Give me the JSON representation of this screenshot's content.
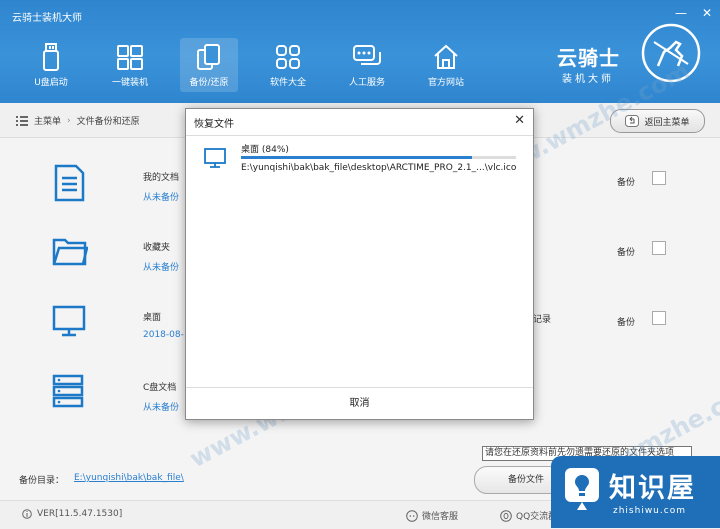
{
  "window": {
    "title": "云骑士装机大师",
    "minimize": "—",
    "close": "✕"
  },
  "nav": [
    {
      "label": "U盘启动",
      "icon": "usb-drive-icon"
    },
    {
      "label": "一键装机",
      "icon": "windows-icon"
    },
    {
      "label": "备份/还原",
      "icon": "backup-restore-icon"
    },
    {
      "label": "软件大全",
      "icon": "apps-grid-icon"
    },
    {
      "label": "人工服务",
      "icon": "chat-bubble-icon"
    },
    {
      "label": "官方网站",
      "icon": "home-icon"
    }
  ],
  "brand": {
    "name": "云骑士",
    "subtitle": "装机大师"
  },
  "breadcrumb": {
    "root": "主菜单",
    "current": "文件备份和还原"
  },
  "back_button": "返回主菜单",
  "rows": [
    {
      "name": "我的文档",
      "sub": "从未备份",
      "right": "",
      "action": "备份",
      "icon": "document-icon"
    },
    {
      "name": "收藏夹",
      "sub": "从未备份",
      "right": "",
      "action": "备份",
      "icon": "folder-icon"
    },
    {
      "name": "桌面",
      "sub": "2018-08-",
      "right": "记录",
      "action": "备份",
      "icon": "monitor-icon"
    },
    {
      "name": "C盘文档",
      "sub": "从未备份",
      "right": "",
      "action": "备份",
      "icon": "server-icon"
    }
  ],
  "footer": {
    "dir_label": "备份目录：",
    "dir_path": "E:\\yunqishi\\bak\\bak_file\\",
    "backup_files_button": "备份文件",
    "tooltip": "请您在还原资料前先勿遗需要还原的文件夹选项"
  },
  "status": {
    "version": "VER[11.5.47.1530]",
    "wechat": "微信客服",
    "qq": "QQ交流群"
  },
  "watermark": "www.wmzhe.com",
  "corner_logo": {
    "name": "知识屋",
    "url": "zhishiwu.com"
  },
  "dialog": {
    "title": "恢复文件",
    "close": "✕",
    "item_name": "桌面",
    "item_percent": "(84%)",
    "progress": 0.84,
    "item_path": "E:\\yunqishi\\bak\\bak_file\\desktop\\ARCTIME_PRO_2.1_...\\vlc.ico",
    "cancel": "取消"
  },
  "colors": {
    "header": "#2f86cf",
    "accent": "#2a7fcf",
    "corner_logo": "#1f6fb8"
  }
}
